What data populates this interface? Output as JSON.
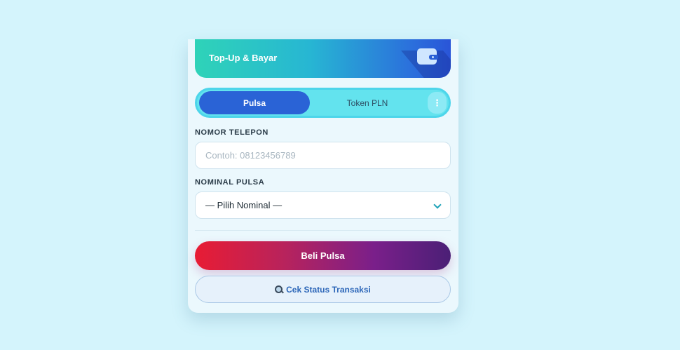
{
  "header": {
    "title": "Top-Up & Bayar",
    "icon": "wallet-icon"
  },
  "tabs": {
    "active": "Pulsa",
    "items": [
      "Pulsa",
      "Token PLN"
    ],
    "more_icon": "⋮"
  },
  "form": {
    "phone_label": "NOMOR TELEPON",
    "phone_placeholder": "Contoh: 08123456789",
    "phone_value": "",
    "nominal_label": "NOMINAL PULSA",
    "nominal_selected": "— Pilih Nominal —"
  },
  "actions": {
    "buy_label": "Beli Pulsa",
    "status_label": "Cek Status Transaksi",
    "status_icon": "magnifier-icon"
  },
  "colors": {
    "page_bg": "#d4f4fc",
    "tab_active": "#2a63d6",
    "buy_gradient_start": "#e81c34",
    "buy_gradient_end": "#4b1f76",
    "status_text": "#2c66b8"
  }
}
